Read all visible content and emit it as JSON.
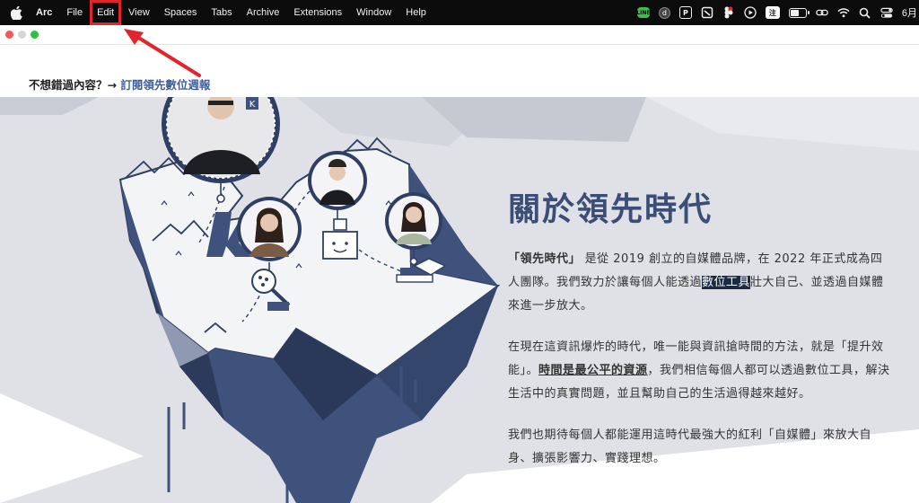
{
  "menubar": {
    "app_name": "Arc",
    "items": [
      "File",
      "Edit",
      "View",
      "Spaces",
      "Tabs",
      "Archive",
      "Extensions",
      "Window",
      "Help"
    ],
    "highlighted_item": "Edit",
    "status_icons": [
      "line-icon",
      "d-avatar-icon",
      "p-boxed-icon",
      "cleanup-icon",
      "figma-icon",
      "play-circle-icon",
      "ime-icon",
      "battery-icon",
      "link-icon",
      "wifi-icon",
      "search-icon",
      "control-center-icon"
    ],
    "line_label": "LINE",
    "avatar_label": "d",
    "boxed_label": "P",
    "ime_label": "注",
    "clock": "6月"
  },
  "banner": {
    "prefix": "不想錯過內容？→ ",
    "link": "訂閱領先數位週報"
  },
  "hero": {
    "logo_badge": "K",
    "title": "關於領先時代",
    "para1": {
      "brand": "「領先時代」",
      "text_a": " 是從 2019 創立的自媒體品牌，在 2022 年正式成為四人團隊。我們致力於讓每個人能透過",
      "selected": "數位工具",
      "text_b": "壯大自己、並透過自媒體來進一步放大。"
    },
    "para2": {
      "text_a": "在現在這資訊爆炸的時代，唯一能與資訊搶時間的方法，就是「提升效能」。",
      "underlined": "時間是最公平的資源",
      "text_b": "，我們相信每個人都可以透過數位工具，解決生活中的真實問題，並且幫助自己的生活過得越來越好。"
    },
    "para3": "我們也期待每個人都能運用這時代最強大的紅利「自媒體」來放大自身、擴張影響力、實踐理想。"
  },
  "colors": {
    "menubar_bg": "#0c0c0c",
    "accent_link": "#3d5e9e",
    "title_color": "#3b4e78",
    "hero_bg": "#dfe1e7",
    "annotation_red": "#e0262c"
  }
}
